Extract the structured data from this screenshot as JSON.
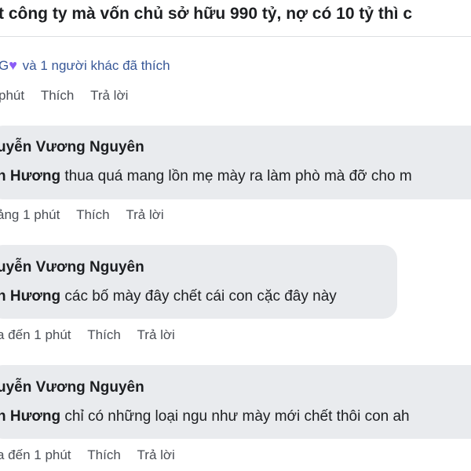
{
  "post": {
    "title": "t công ty mà vốn chủ sở hữu 990 tỷ, nợ có 10 tỷ thì c"
  },
  "like_summary": {
    "prefix": "G",
    "heart_icon": "purple-heart-icon",
    "text": "và 1 người khác đã thích"
  },
  "top_actions": {
    "time": "phút",
    "like": "Thích",
    "reply": "Trả lời"
  },
  "comments": [
    {
      "author": "uyễn Vương Nguyên",
      "mention": "n Hương",
      "text": " thua quá mang lồn mẹ mày ra làm phò mà đỡ cho m",
      "time": "ảng 1 phút",
      "like": "Thích",
      "reply": "Trả lời"
    },
    {
      "author": "uyễn Vương Nguyên",
      "mention": "n Hương",
      "text": " các bố mày đây chết cái con cặc đây này",
      "time": "a đến 1 phút",
      "like": "Thích",
      "reply": "Trả lời"
    },
    {
      "author": "uyễn Vương Nguyên",
      "mention": "n Hương",
      "text": " chỉ có những loại ngu như mày mới chết thôi con ah",
      "time": "a đến 1 phút",
      "like": "Thích",
      "reply": "Trả lời"
    }
  ],
  "colors": {
    "bubble_bg": "#e9ebee",
    "link": "#385898",
    "meta": "#4b4f56",
    "heart": "#8b5cf6"
  }
}
